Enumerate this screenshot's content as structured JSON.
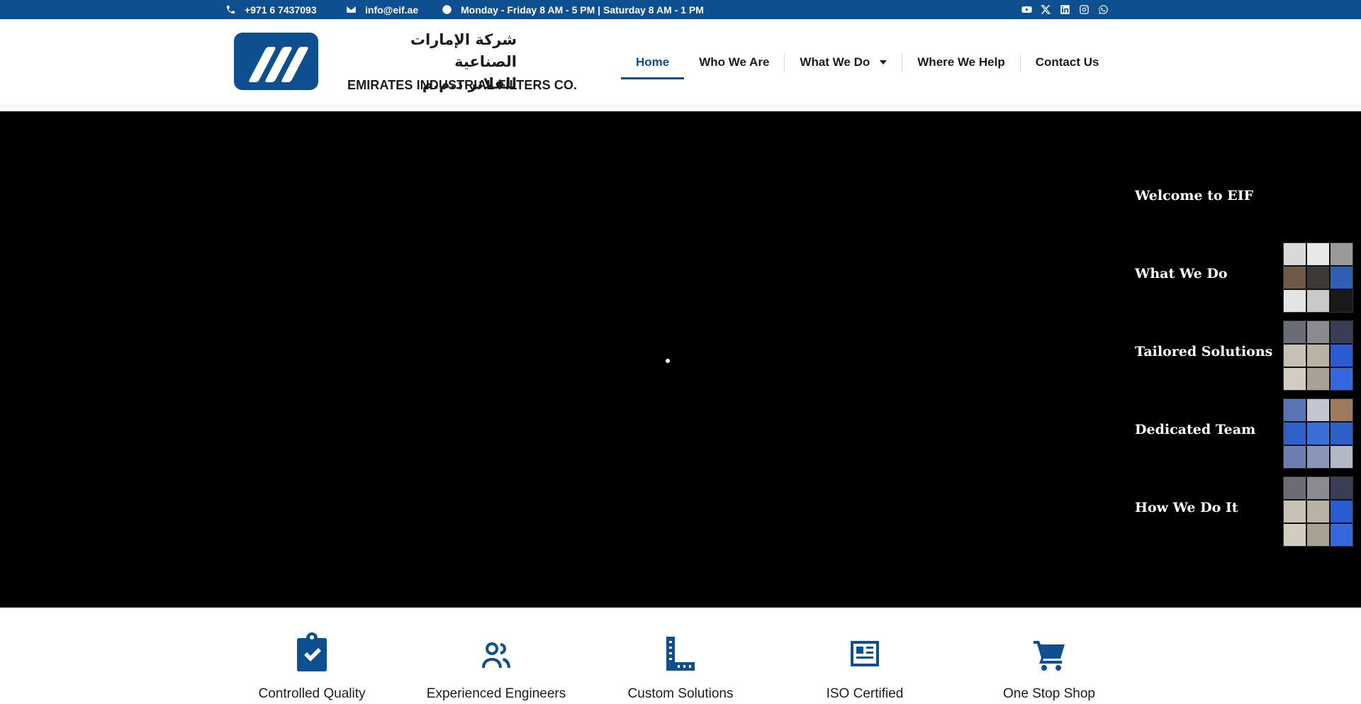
{
  "topbar": {
    "phone": "+971 6 7437093",
    "email": "info@eif.ae",
    "hours": "Monday - Friday 8 AM - 5 PM | Saturday 8 AM - 1 PM",
    "socials": [
      "youtube-icon",
      "x-twitter-icon",
      "linkedin-icon",
      "instagram-icon",
      "whatsapp-icon"
    ]
  },
  "brand": {
    "arabic_line1": "شركة الإمارات الصناعية",
    "arabic_line2": "للفلاتر ذ.م.م",
    "english": "EMIRATES INDUSTRIAL FILTERS CO."
  },
  "nav": {
    "items": [
      {
        "label": "Home",
        "active": true
      },
      {
        "label": "Who We Are"
      },
      {
        "label": "What We Do",
        "has_dropdown": true
      },
      {
        "label": "Where We Help"
      },
      {
        "label": "Contact Us"
      }
    ]
  },
  "hero": {
    "slides": [
      {
        "title": "Welcome to EIF"
      },
      {
        "title": "What We Do"
      },
      {
        "title": "Tailored Solutions"
      },
      {
        "title": "Dedicated Team"
      },
      {
        "title": "How We Do It"
      }
    ]
  },
  "features": {
    "items": [
      {
        "label": "Controlled Quality",
        "icon": "clipboard-check-icon"
      },
      {
        "label": "Experienced Engineers",
        "icon": "users-icon"
      },
      {
        "label": "Custom Solutions",
        "icon": "ruler-icon"
      },
      {
        "label": "ISO Certified",
        "icon": "newspaper-icon"
      },
      {
        "label": "One Stop Shop",
        "icon": "shopping-cart-icon"
      }
    ]
  },
  "colors": {
    "brand_blue": "#0d4f8f",
    "hero_background": "#000000"
  }
}
